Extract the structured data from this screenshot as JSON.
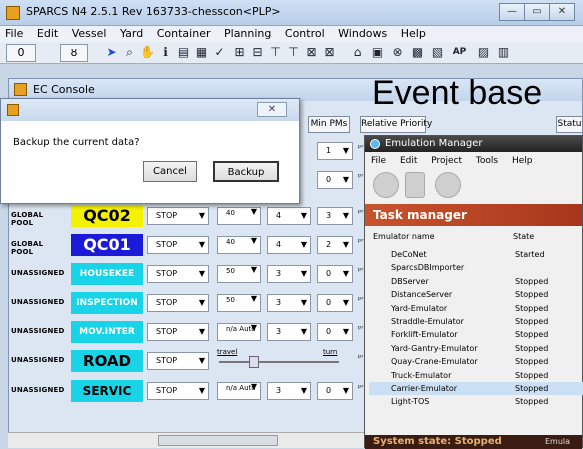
{
  "window": {
    "title": "SPARCS N4 2.5.1  Rev 163733-chesscon<PLP>"
  },
  "menu": [
    "File",
    "Edit",
    "Vessel",
    "Yard",
    "Container",
    "Planning",
    "Control",
    "Windows",
    "Help"
  ],
  "toolbar": {
    "counter": "0",
    "tool": "ȣ"
  },
  "ec_console": {
    "title": "EC Console"
  },
  "overlay_text": "Event base",
  "header_buttons": {
    "min_pms": "Min PMs",
    "relative_priority": "Relative Priority",
    "status": "Statu"
  },
  "backup_dialog": {
    "question": "Backup the current data?",
    "cancel": "Cancel",
    "backup": "Backup",
    "close": "✕"
  },
  "rows": [
    {
      "pool": "",
      "name": "",
      "mode": "",
      "v1": "",
      "v2": "",
      "v3": "1"
    },
    {
      "pool": "",
      "name": "",
      "mode": "",
      "v1": "",
      "v2": "",
      "v3": "0"
    },
    {
      "pool": "GLOBAL POOL",
      "name": "QC02",
      "mode": "STOP",
      "v1": "40",
      "v2": "4",
      "v3": "3"
    },
    {
      "pool": "GLOBAL POOL",
      "name": "QC01",
      "mode": "STOP",
      "v1": "40",
      "v2": "4",
      "v3": "2"
    },
    {
      "pool": "UNASSIGNED",
      "name": "HOUSEKEE",
      "mode": "STOP",
      "v1": "50",
      "v2": "3",
      "v3": "0"
    },
    {
      "pool": "UNASSIGNED",
      "name": "INSPECTION",
      "mode": "STOP",
      "v1": "50",
      "v2": "3",
      "v3": "0"
    },
    {
      "pool": "UNASSIGNED",
      "name": "MOV.INTER",
      "mode": "STOP",
      "v1": "n/a Auto",
      "v2": "3",
      "v3": "0"
    },
    {
      "pool": "UNASSIGNED",
      "name": "ROAD",
      "mode": "STOP",
      "slider_left": "travel",
      "slider_right": "turn"
    },
    {
      "pool": "UNASSIGNED",
      "name": "SERVIC",
      "mode": "STOP",
      "v1": "n/a Auto",
      "v2": "3",
      "v3": "0"
    }
  ],
  "emulation_manager": {
    "title": "Emulation Manager",
    "menu": [
      "File",
      "Edit",
      "Project",
      "Tools",
      "Help"
    ],
    "task_header": "Task manager",
    "columns": {
      "name": "Emulator name",
      "state": "State"
    },
    "emulators": [
      {
        "name": "DeCoNet",
        "state": "Started"
      },
      {
        "name": "SparcsDBImporter",
        "state": ""
      },
      {
        "name": "DBServer",
        "state": "Stopped"
      },
      {
        "name": "DistanceServer",
        "state": "Stopped"
      },
      {
        "name": "Yard-Emulator",
        "state": "Stopped"
      },
      {
        "name": "Straddle-Emulator",
        "state": "Stopped"
      },
      {
        "name": "Forklift-Emulator",
        "state": "Stopped"
      },
      {
        "name": "Yard-Gantry-Emulator",
        "state": "Stopped"
      },
      {
        "name": "Quay-Crane-Emulator",
        "state": "Stopped"
      },
      {
        "name": "Truck-Emulator",
        "state": "Stopped"
      },
      {
        "name": "Carrier-Emulator",
        "state": "Stopped"
      },
      {
        "name": "Light-TOS",
        "state": "Stopped"
      }
    ],
    "selected": "Carrier-Emulator",
    "system_state": "System state:  Stopped",
    "footer_right": "Emula"
  },
  "colors": {
    "qc_yellow": "#f5f200",
    "qc_blue": "#1a1ad8",
    "cyan": "#19d3e6",
    "task_red": "#c0482a"
  }
}
